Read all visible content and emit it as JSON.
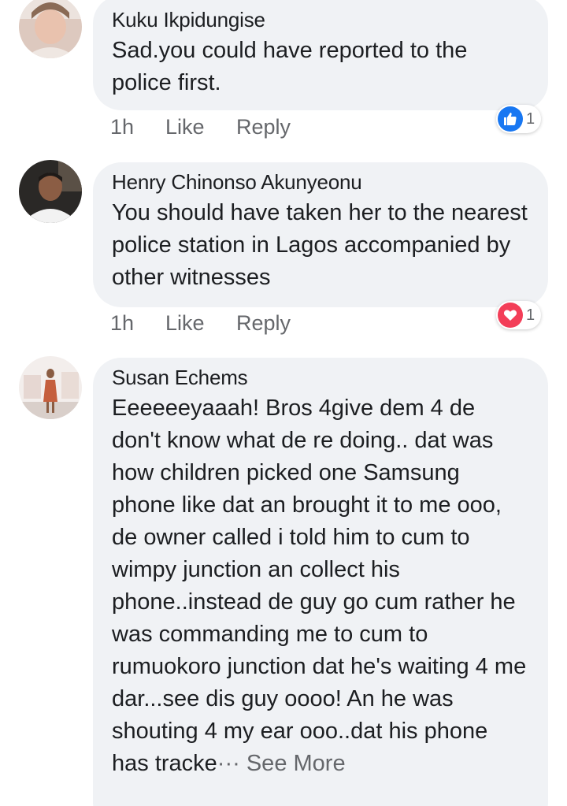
{
  "comments": [
    {
      "author": "Kuku Ikpidungise",
      "text": "Sad.you could have reported to the police first.",
      "time": "1h",
      "like_label": "Like",
      "reply_label": "Reply",
      "reaction": {
        "type": "like",
        "icon": "thumbs-up-icon",
        "color": "#1877f2",
        "count": "1"
      }
    },
    {
      "author": "Henry Chinonso Akunyeonu",
      "text": "You should have taken her to the nearest police station in Lagos accompanied by other witnesses",
      "time": "1h",
      "like_label": "Like",
      "reply_label": "Reply",
      "reaction": {
        "type": "love",
        "icon": "heart-icon",
        "color": "#f33e58",
        "count": "1"
      }
    },
    {
      "author": "Susan Echems",
      "text": "Eeeeeeyaaah! Bros 4give dem 4 de don't know what de re doing.. dat was how children  picked one Samsung phone like dat an brought it to me ooo, de owner called i told him to cum to wimpy junction an collect his phone..instead de guy go cum rather he was commanding me to cum to rumuokoro junction dat he's waiting 4 me dar...see dis guy oooo! An he was shouting 4 my ear ooo..dat his phone has tracke",
      "ellipsis": "···",
      "see_more": "See More"
    }
  ],
  "colors": {
    "bubble": "#f0f2f5",
    "text": "#1c1e21",
    "secondary": "#65676b"
  }
}
